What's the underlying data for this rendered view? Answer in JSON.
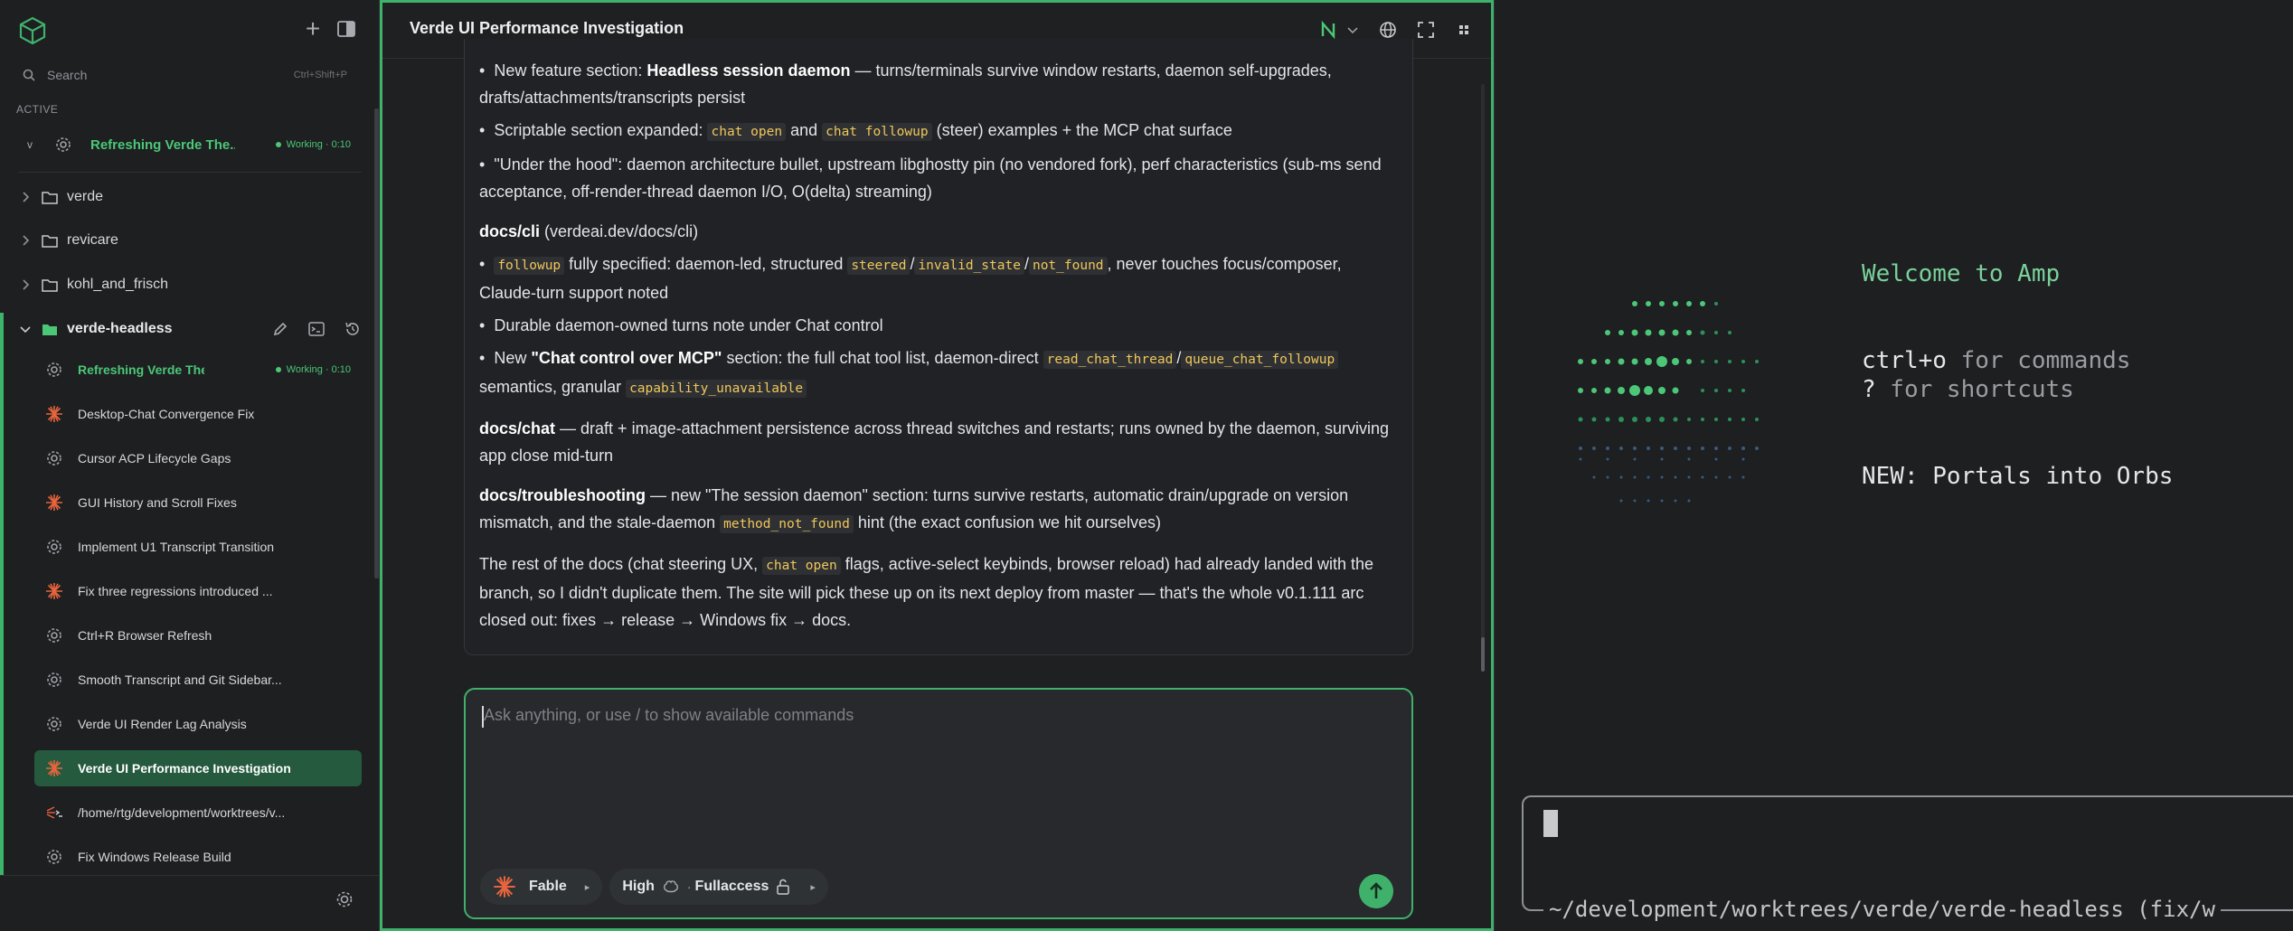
{
  "sidebar": {
    "search_placeholder": "Search",
    "search_shortcut": "Ctrl+Shift+P",
    "section_active": "ACTIVE",
    "active_thread": {
      "collapse": "v",
      "title": "Refreshing Verde The...",
      "status": "Working · 0:10"
    },
    "folders": [
      {
        "name": "verde"
      },
      {
        "name": "revicare"
      },
      {
        "name": "kohl_and_frisch"
      },
      {
        "name": "verde-headless"
      }
    ],
    "threads": [
      {
        "title": "Refreshing Verde Them...",
        "status": "Working · 0:10",
        "icon": "spinner-icon"
      },
      {
        "title": "Desktop-Chat Convergence Fix",
        "icon": "starburst-icon"
      },
      {
        "title": "Cursor ACP Lifecycle Gaps",
        "icon": "spinner-icon"
      },
      {
        "title": "GUI History and Scroll Fixes",
        "icon": "starburst-icon"
      },
      {
        "title": "Implement U1 Transcript Transition",
        "icon": "spinner-icon"
      },
      {
        "title": "Fix three regressions introduced ...",
        "icon": "starburst-icon"
      },
      {
        "title": "Ctrl+R Browser Refresh",
        "icon": "spinner-icon"
      },
      {
        "title": "Smooth Transcript and Git Sidebar...",
        "icon": "spinner-icon"
      },
      {
        "title": "Verde UI Render Lag Analysis",
        "icon": "spinner-icon"
      },
      {
        "title": "Verde UI Performance Investigation",
        "icon": "starburst-icon"
      },
      {
        "title": "/home/rtg/development/worktrees/v...",
        "icon": "terminal-icon"
      },
      {
        "title": "Fix Windows Release Build",
        "icon": "spinner-icon"
      }
    ]
  },
  "main": {
    "title": "Verde UI Performance Investigation",
    "composer_placeholder": "Ask anything, or use / to show available commands",
    "agent": "Fable",
    "effort": "High",
    "access": "Fullaccess",
    "p1_pre": "New feature section: ",
    "p1_bold": "Headless session daemon",
    "p1_post": " — turns/terminals survive window restarts, daemon self-upgrades, drafts/attachments/transcripts persist",
    "p2_pre": "Scriptable section expanded: ",
    "p2_code1": "chat open",
    "p2_mid": " and ",
    "p2_code2": "chat followup",
    "p2_post": " (steer) examples + the MCP chat surface",
    "p3": "\"Under the hood\": daemon architecture bullet, upstream libghostty pin (no vendored fork), perf characteristics (sub-ms send acceptance, off-render-thread daemon I/O, O(delta) streaming)",
    "h_cli_bold": "docs/cli",
    "h_cli_rest": " (verdeai.dev/docs/cli)",
    "c1_code1": "followup",
    "c1_mid1": " fully specified: daemon-led, structured ",
    "c1_code2": "steered",
    "c1_code3": "invalid_state",
    "c1_code4": "not_found",
    "c1_post": ", never touches focus/composer, Claude-turn support noted",
    "slash": "/",
    "c2": "Durable daemon-owned turns note under Chat control",
    "c3_pre": "New ",
    "c3_bold": "\"Chat control over MCP\"",
    "c3_mid": " section: the full chat tool list, daemon-direct ",
    "c3_code1": "read_chat_thread",
    "c3_code2": "queue_chat_followup",
    "c3_post1": " semantics, granular ",
    "c3_code3": "capability_unavailable",
    "chat_bold": "docs/chat",
    "chat_rest": " — draft + image-attachment persistence across thread switches and restarts; runs owned by the daemon, surviving app close mid-turn",
    "ts_bold": "docs/troubleshooting",
    "ts_rest1": " — new \"The session daemon\" section: turns survive restarts, automatic drain/upgrade on version mismatch, and the stale-daemon ",
    "ts_code": "method_not_found",
    "ts_rest2": " hint (the exact confusion we hit ourselves)",
    "rest_pre": "The rest of the docs (chat steering UX, ",
    "rest_code": "chat open",
    "rest_post": " flags, active-select keybinds, browser reload) had already landed with the branch, so I didn't duplicate them. The site will pick these up on its next deploy from master — that's the whole v0.1.111 arc closed out: fixes → release → Windows fix → docs.",
    "bullet": "•"
  },
  "terminal": {
    "welcome": "Welcome to Amp",
    "line1_key": "ctrl+o",
    "line1_desc": " for commands",
    "line2_key": "?",
    "line2_desc": " for shortcuts",
    "news": "NEW: Portals into Orbs",
    "path": "~/development/worktrees/verde/verde-headless (fix/w"
  },
  "colors": {
    "accent": "#3fb16b",
    "selected": "#255a3e",
    "code": "#f0c75a",
    "orange": "#e8643c"
  }
}
